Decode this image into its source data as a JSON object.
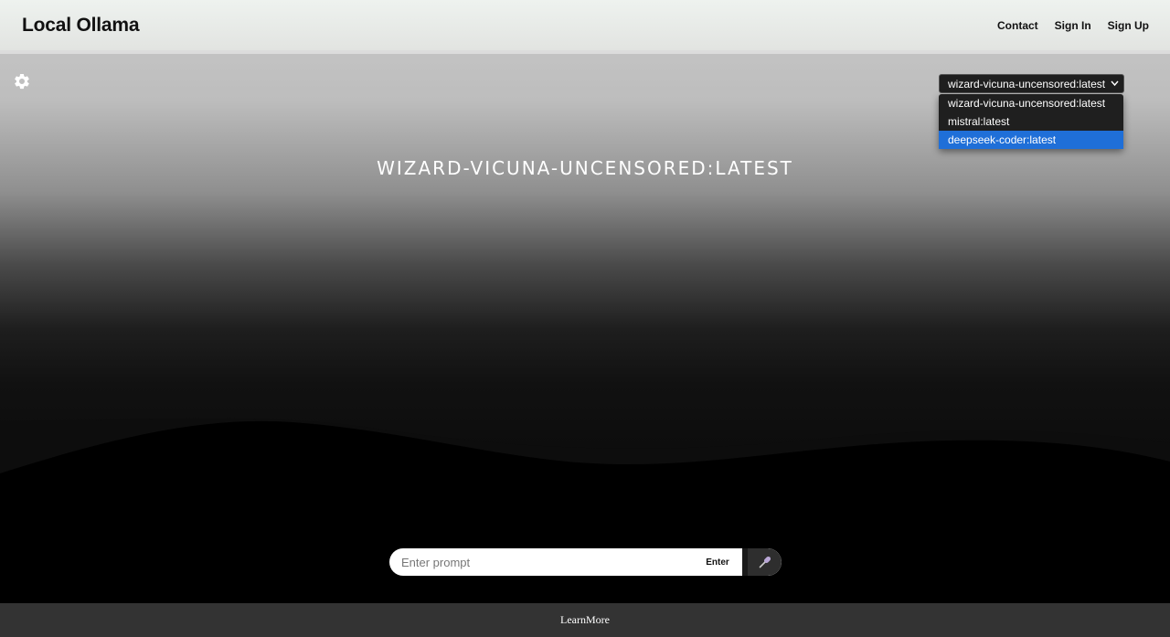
{
  "header": {
    "brand": "Local Ollama",
    "nav": {
      "contact": "Contact",
      "sign_in": "Sign In",
      "sign_up": "Sign Up"
    }
  },
  "settings": {
    "icon": "gear-icon"
  },
  "model_select": {
    "selected": "wizard-vicuna-uncensored:latest",
    "options": [
      "wizard-vicuna-uncensored:latest",
      "mistral:latest",
      "deepseek-coder:latest"
    ],
    "highlighted_option": "deepseek-coder:latest",
    "highlight_color": "#1f6fd8"
  },
  "main": {
    "model_title": "wizard-vicuna-uncensored:latest"
  },
  "prompt": {
    "placeholder": "Enter prompt",
    "value": "",
    "enter_label": "Enter",
    "mic_icon": "microphone-icon"
  },
  "footer": {
    "link": "LearnMore"
  }
}
